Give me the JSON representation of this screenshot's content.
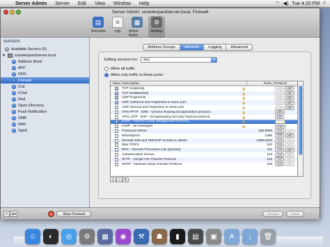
{
  "menubar": {
    "app_name": "Server Admin",
    "items": [
      "Server",
      "Edit",
      "View",
      "Window",
      "Help"
    ],
    "clock": "Tue 4:20 PM"
  },
  "window": {
    "title": "Server Admin: snowleopardserver.local: Firewall",
    "toolbar": [
      {
        "label": "Overview",
        "icon": "overview-icon",
        "color": "#3b6fc4"
      },
      {
        "label": "Log",
        "icon": "log-icon",
        "color": "#8a8a8a"
      },
      {
        "label": "Active Rules",
        "icon": "active-rules-icon",
        "color": "#5a7da8"
      },
      {
        "label": "Settings",
        "icon": "settings-icon",
        "color": "#6a6a6a"
      }
    ]
  },
  "sidebar": {
    "header": "SERVERS",
    "available": "Available Servers (0)",
    "server": "snowleopardserver.local",
    "services": [
      "Address Book",
      "AFP",
      "DNS",
      "Firewall",
      "iCal",
      "iChat",
      "Mail",
      "Open Directory",
      "Push Notification",
      "SMB",
      "Web",
      "Xgrid"
    ],
    "selected": "Firewall"
  },
  "tabs": [
    "Address Groups",
    "Services",
    "Logging",
    "Advanced"
  ],
  "active_tab": "Services",
  "editing": {
    "label": "Editing services for:",
    "value": "any"
  },
  "radios": {
    "allow_all": "Allow all traffic",
    "allow_only": "Allow only traffic to these ports:"
  },
  "table": {
    "headers": {
      "allow": "Allow",
      "description": "Description",
      "ports": "Ports",
      "protocol": "Protocol"
    },
    "rows": [
      {
        "allow": true,
        "desc": "TCP (outgoing)",
        "lock": true,
        "ports": "",
        "tcp": "TCP",
        "udp": "UDP",
        "tcp_dim": true,
        "udp_dim": false
      },
      {
        "allow": true,
        "desc": "TCP (established)",
        "lock": true,
        "ports": "",
        "tcp": "TCP",
        "udp": "UDP",
        "tcp_dim": true,
        "udp_dim": false
      },
      {
        "allow": true,
        "desc": "UDP Fragments",
        "lock": true,
        "ports": "",
        "tcp": "TCP",
        "udp": "UDP",
        "tcp_dim": true,
        "udp_dim": false
      },
      {
        "allow": true,
        "desc": "UDP outbound and responses to same port",
        "lock": true,
        "ports": "",
        "tcp": "TCP",
        "udp": "UDP",
        "tcp_dim": true,
        "udp_dim": false
      },
      {
        "allow": false,
        "desc": "UDP inbound and responses to same port",
        "lock": true,
        "ports": "",
        "tcp": "TCP",
        "udp": "UDP",
        "tcp_dim": true,
        "udp_dim": false
      },
      {
        "allow": false,
        "desc": "VPN PPTP : GRE - Generic Routing Encapsulation protocol",
        "lock": true,
        "ports": "",
        "tcp": "GRE",
        "udp": "",
        "tcp_dim": false,
        "udp_dim": false
      },
      {
        "allow": false,
        "desc": "VPN L2TP : ESP - Encapsulating Security Payload protocol",
        "lock": true,
        "ports": "",
        "tcp": "ESP",
        "udp": "",
        "tcp_dim": false,
        "udp_dim": false
      },
      {
        "allow": true,
        "desc": "IGMP - Internet Group Management Protocol",
        "lock": true,
        "ports": "",
        "tcp": "ICMP",
        "udp": "",
        "tcp_dim": false,
        "udp_dim": false,
        "selected": true
      },
      {
        "allow": false,
        "desc": "ICMP - all messages",
        "lock": true,
        "ports": "",
        "tcp": "ICMP",
        "udp": "",
        "tcp_dim": false,
        "udp_dim": false
      },
      {
        "allow": false,
        "desc": "Password Server",
        "lock": false,
        "ports": "106,3659",
        "tcp": "TCP",
        "udp": "UDP",
        "tcp_dim": false,
        "udp_dim": true
      },
      {
        "allow": false,
        "desc": "WebObjects",
        "lock": false,
        "ports": "1085",
        "tcp": "TCP",
        "udp": "UDP",
        "tcp_dim": false,
        "udp_dim": false
      },
      {
        "allow": false,
        "desc": "Remote RMI and RMI/IIOP access to JBoss",
        "lock": false,
        "ports": "1099,8043",
        "tcp": "TCP",
        "udp": "UDP",
        "tcp_dim": false,
        "udp_dim": true
      },
      {
        "allow": false,
        "desc": "Mail: POP3",
        "lock": false,
        "ports": "110",
        "tcp": "TCP",
        "udp": "UDP",
        "tcp_dim": false,
        "udp_dim": true
      },
      {
        "allow": false,
        "desc": "RPC - Remote Procedure Call (rpcbind)",
        "lock": false,
        "ports": "111",
        "tcp": "TCP",
        "udp": "UDP",
        "tcp_dim": false,
        "udp_dim": false
      },
      {
        "allow": false,
        "desc": "Authentication service",
        "lock": false,
        "ports": "113",
        "tcp": "TCP",
        "udp": "UDP",
        "tcp_dim": false,
        "udp_dim": true
      },
      {
        "allow": false,
        "desc": "SFTP - Simple File Transfer Protocol",
        "lock": false,
        "ports": "115",
        "tcp": "TCP",
        "udp": "UDP",
        "tcp_dim": false,
        "udp_dim": true
      },
      {
        "allow": false,
        "desc": "NNTP - Network News Transfer Protocol",
        "lock": false,
        "ports": "119",
        "tcp": "TCP",
        "udp": "UDP",
        "tcp_dim": false,
        "udp_dim": true
      }
    ]
  },
  "footer": {
    "stop_label": "Stop Firewall",
    "revert": "Revert",
    "save": "Save"
  },
  "dock": [
    {
      "name": "finder-icon",
      "color": "#3a86e0",
      "glyph": "☺"
    },
    {
      "name": "dashboard-icon",
      "color": "#2a2a2a",
      "glyph": "◐"
    },
    {
      "name": "safari-icon",
      "color": "#4aa0e8",
      "glyph": "◎"
    },
    {
      "name": "system-preferences-icon",
      "color": "#7a7a7a",
      "glyph": "⚙"
    },
    {
      "name": "server-admin-icon",
      "color": "#5a6aa0",
      "glyph": "▦"
    },
    {
      "name": "podcast-icon",
      "color": "#9a4ad0",
      "glyph": "◉"
    },
    {
      "name": "xcode-icon",
      "color": "#3a6ab0",
      "glyph": "⚒"
    },
    {
      "name": "workgroup-manager-icon",
      "color": "#8a6a4a",
      "glyph": "☗"
    },
    {
      "name": "terminal-icon",
      "color": "#1a1a1a",
      "glyph": "▮"
    },
    {
      "name": "activity-monitor-icon",
      "color": "#4a4a4a",
      "glyph": "▤"
    },
    {
      "name": "server-app-icon",
      "color": "#8a8a8a",
      "glyph": "▣"
    },
    {
      "name": "applications-folder-icon",
      "color": "#7fa8d8",
      "glyph": "A"
    },
    {
      "name": "downloads-folder-icon",
      "color": "#7fa8d8",
      "glyph": "↓"
    },
    {
      "name": "trash-icon",
      "color": "#9aa0a8",
      "glyph": "🗑"
    }
  ]
}
